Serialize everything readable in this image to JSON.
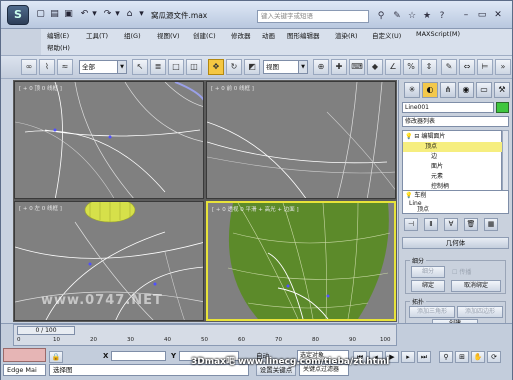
{
  "titlebar": {
    "app_icon": "3ds-max-logo-icon",
    "title": "窝瓜源文件.max",
    "search_placeholder": "键入关键字或短语"
  },
  "menu": {
    "row1": [
      "编辑(E)",
      "工具(T)",
      "组(G)",
      "视图(V)",
      "创建(C)",
      "修改器",
      "动画",
      "图形编辑器",
      "渲染(R)",
      "自定义(U)",
      "MAXScript(M)"
    ],
    "row2": [
      "帮助(H)"
    ]
  },
  "toolbar": {
    "selection_filter": "全部",
    "ref_coord": "视图"
  },
  "viewports": {
    "top_left_label": "[ + 0 顶 0 线框 ]",
    "top_right_label": "[ + 0 前 0 线框 ]",
    "bottom_left_label": "[ + 0 左 0 线框 ]",
    "bottom_right_label": "[ + 0 透视 0 平滑 + 高光 + 边面 ]"
  },
  "command_panel": {
    "object_name": "Line001",
    "object_color": "#3ec63e",
    "modifier_list": "修改器列表",
    "stack": [
      {
        "label": "⊟ 编辑面片",
        "selected": false
      },
      {
        "label": "顶点",
        "selected": true
      },
      {
        "label": "边",
        "selected": false
      },
      {
        "label": "面片",
        "selected": false
      },
      {
        "label": "元素",
        "selected": false
      },
      {
        "label": "控制柄",
        "selected": false
      }
    ],
    "stack_lower": [
      "车削",
      "Line",
      "顶点"
    ],
    "rollout_title": "几何体",
    "subdivide_group": "细分",
    "subdivide_btn": "细分",
    "propagate_label": "传播",
    "bind_btn": "绑定",
    "unbind_btn": "取消绑定",
    "topology_group": "拓扑",
    "add_tri_btn": "添加三角形",
    "add_quad_btn": "添加四边形",
    "create_btn": "创建"
  },
  "timeline": {
    "frame_display": "0 / 100",
    "ticks": [
      "0",
      "10",
      "20",
      "30",
      "40",
      "50",
      "60",
      "70",
      "80",
      "90",
      "100"
    ]
  },
  "status": {
    "maxscript_label": "Edge Mai",
    "prompt": "选择图",
    "coord_x_label": "X",
    "coord_y_label": "Y",
    "auto_key": "自动",
    "key_combo": "选定对象",
    "set_key": "设置关键点",
    "key_filters": "关键点过滤器"
  },
  "watermarks": {
    "site": "www.0747.NET",
    "brand": "3Dmax吧 www.linecg.com/tieba/zt.html"
  }
}
